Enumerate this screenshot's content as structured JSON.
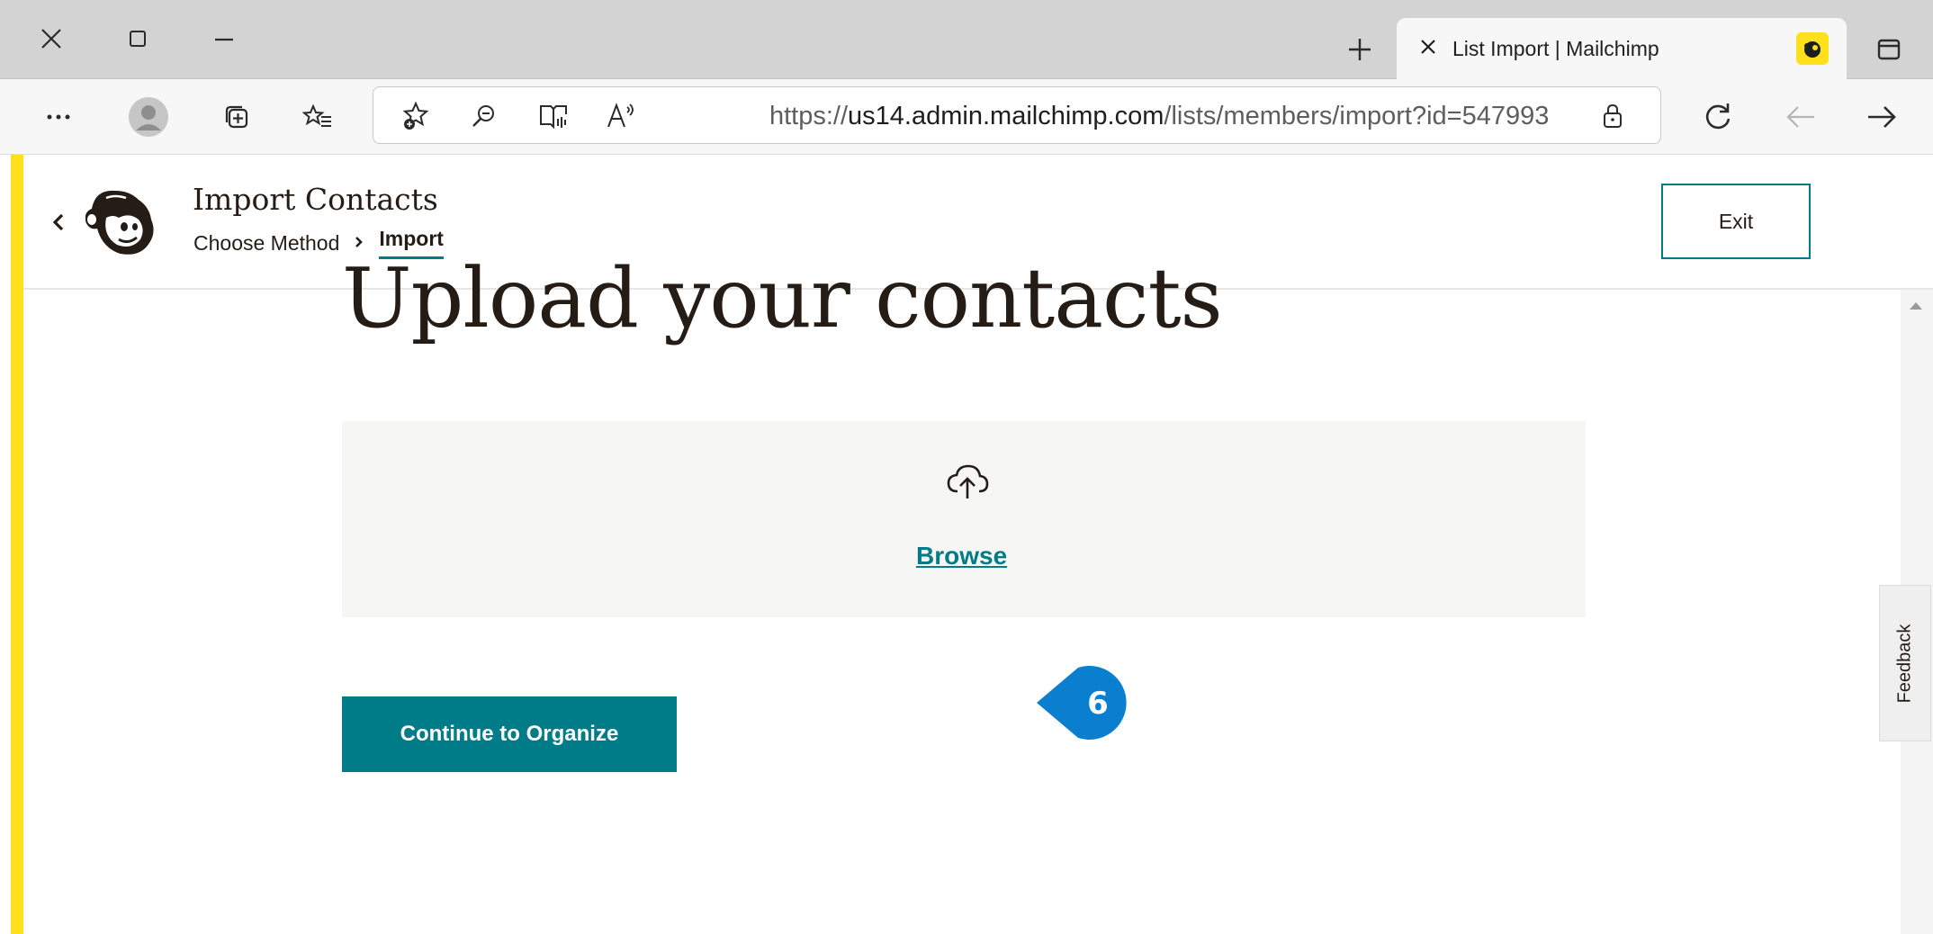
{
  "browser": {
    "tab": {
      "title": "List Import | Mailchimp",
      "favicon": "mailchimp-favicon"
    },
    "address_bar": {
      "url_prefix": "https://",
      "url_domain": "us14.admin.mailchimp.com",
      "url_path": "/lists/members/import?id=547993"
    },
    "icons": [
      "close-icon",
      "maximize-icon",
      "minimize-icon",
      "new-tab-icon",
      "tab-close-icon",
      "window-icon",
      "more-icon",
      "profile-icon",
      "collections-icon",
      "favorites-icon",
      "add-favorite-icon",
      "zoom-icon",
      "immersive-reader-icon",
      "read-aloud-icon",
      "lock-icon",
      "refresh-icon",
      "back-icon",
      "forward-icon"
    ]
  },
  "header": {
    "title": "Import Contacts",
    "breadcrumb": {
      "step1": "Choose Method",
      "step2": "Import"
    },
    "exit_label": "Exit"
  },
  "main": {
    "title": "Upload your contacts",
    "upload": {
      "icon": "cloud-upload-icon",
      "browse_label": "Browse"
    },
    "callout_number": "6",
    "continue_label": "Continue to Organize"
  },
  "feedback_label": "Feedback",
  "colors": {
    "accent": "#007c89",
    "brand_yellow": "#ffe01b",
    "callout_blue": "#0a7fd0",
    "text": "#241c15"
  }
}
